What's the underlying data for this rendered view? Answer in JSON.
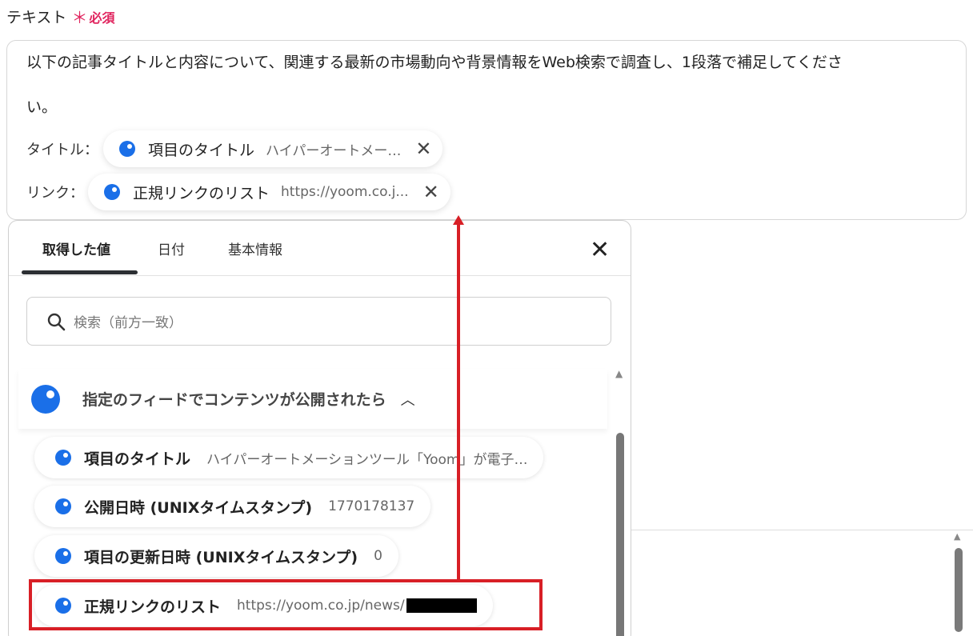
{
  "field": {
    "label": "テキスト",
    "required_star": "＊",
    "required_text": "必須"
  },
  "prompt": {
    "line1": "以下の記事タイトルと内容について、関連する最新の市場動向や背景情報をWeb検索で調査し、1段落で補足してくださ",
    "line2": "い。",
    "title_label": "タイトル：",
    "link_label": "リンク："
  },
  "chips": [
    {
      "name": "項目のタイトル",
      "value": "ハイパーオートメー…",
      "close": "✕"
    },
    {
      "name": "正規リンクのリスト",
      "value": "https://yoom.co.j...",
      "close": "✕"
    }
  ],
  "panel": {
    "tabs": [
      "取得した値",
      "日付",
      "基本情報"
    ],
    "active_tab": "取得した値",
    "close": "✕",
    "search_placeholder": "検索（前方一致）",
    "group_title": "指定のフィードでコンテンツが公開されたら",
    "group_chevron": "︿",
    "items": [
      {
        "name": "項目のタイトル",
        "value": "ハイパーオートメーションツール「Yoom」が電子…"
      },
      {
        "name": "公開日時 (UNIXタイムスタンプ)",
        "value": "1770178137"
      },
      {
        "name": "項目の更新日時 (UNIXタイムスタンプ)",
        "value": "0"
      },
      {
        "name": "正規リンクのリスト",
        "value": "https://yoom.co.jp/news/"
      }
    ]
  },
  "colors": {
    "accent": "#1a6fe8",
    "required": "#e0245e",
    "annotation": "#d81f26"
  },
  "icons": [
    "item-dot-icon",
    "search-icon",
    "close-icon",
    "chevron-up-icon",
    "scroll-up-icon"
  ]
}
